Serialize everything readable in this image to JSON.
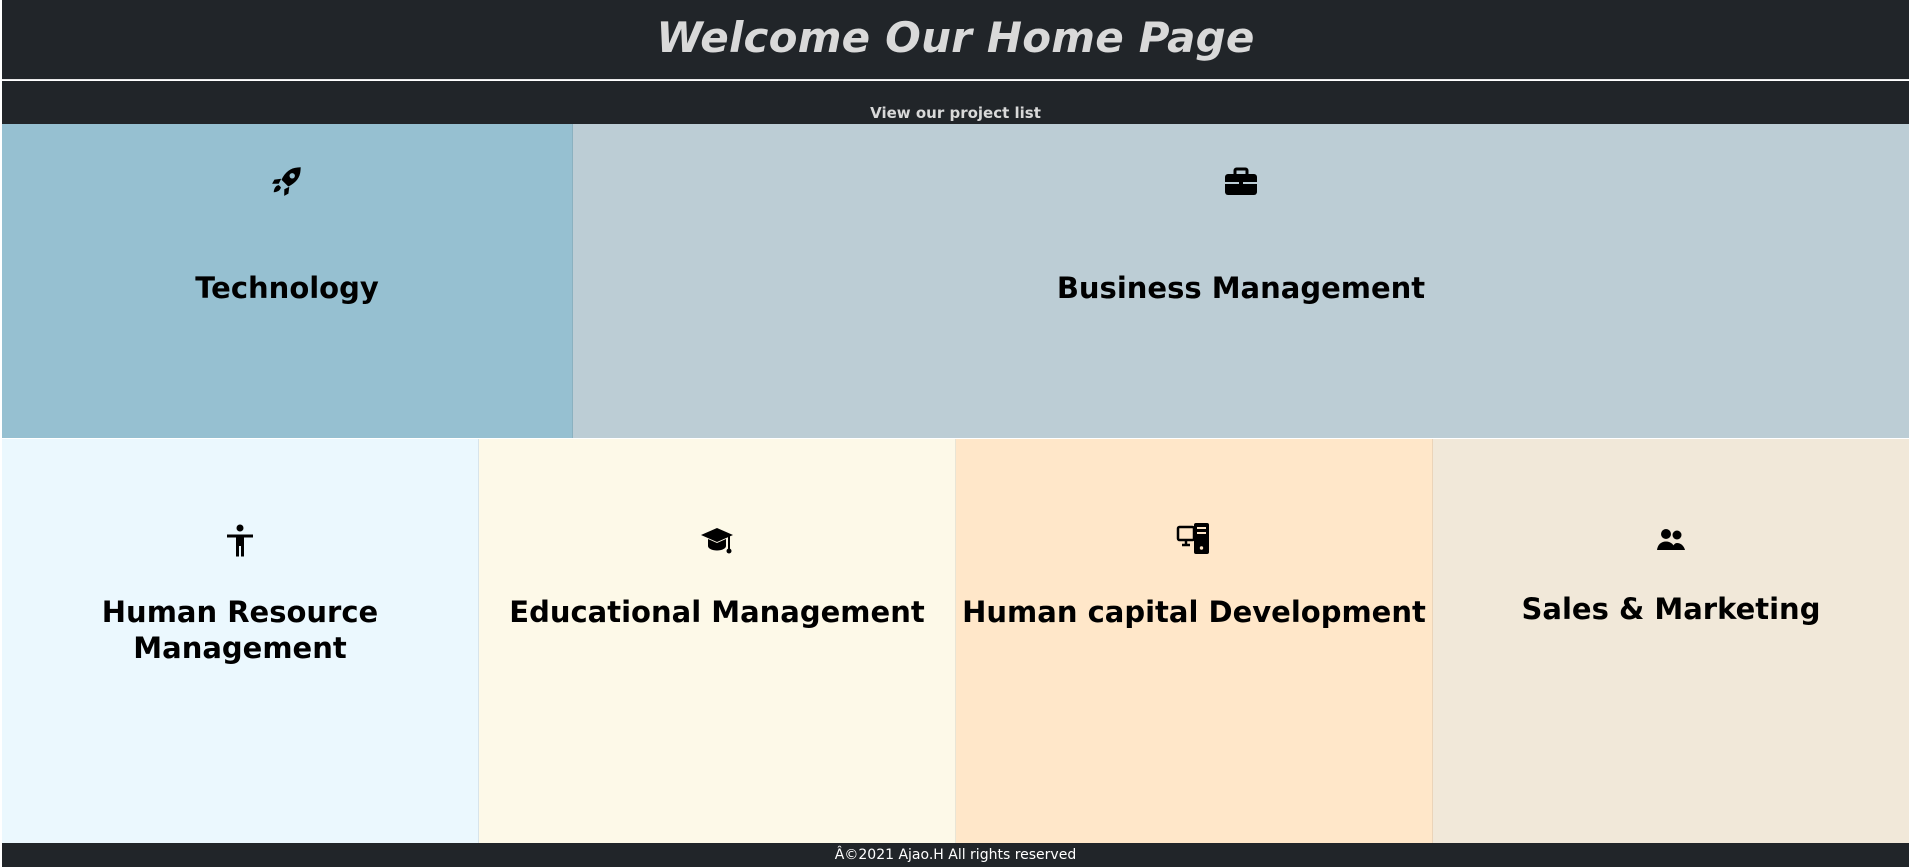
{
  "header": {
    "title": "Welcome Our Home Page"
  },
  "navigation": {
    "project_link": "View our project list"
  },
  "categories_top": [
    {
      "label": "Technology",
      "icon": "rocket-icon",
      "background": "#96c0d1"
    },
    {
      "label": "Business Management",
      "icon": "briefcase-icon",
      "background": "#bccdd5"
    }
  ],
  "categories_bottom": [
    {
      "label": "Human Resource Management",
      "icon": "person-icon",
      "background": "#ebf8fe"
    },
    {
      "label": "Educational Management",
      "icon": "graduation-cap-icon",
      "background": "#fdf9e8"
    },
    {
      "label": "Human capital Development",
      "icon": "devices-icon",
      "background": "#ffe7c9"
    },
    {
      "label": "Sales & Marketing",
      "icon": "people-icon",
      "background": "#f1e8d9"
    }
  ],
  "footer": {
    "text": "Â©2021 Ajao.H All rights reserved"
  },
  "colors": {
    "header_background": "#212529",
    "header_text": "#d9d9d9"
  }
}
